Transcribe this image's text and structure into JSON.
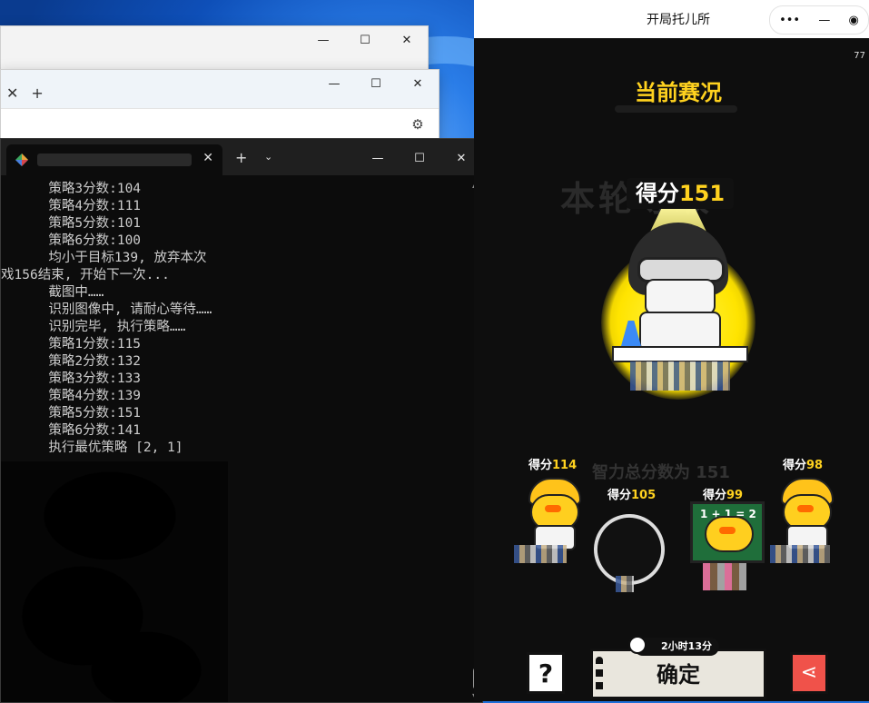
{
  "background_windows": {
    "win1_caption": {
      "min": "—",
      "max": "☐",
      "close": "✕"
    },
    "win2_tab_close": "✕",
    "win2_new_tab": "+",
    "win2_caption": {
      "min": "—",
      "max": "☐",
      "close": "✕"
    }
  },
  "terminal": {
    "tab_close": "✕",
    "new_tab": "+",
    "dropdown": "⌄",
    "caption": {
      "min": "—",
      "max": "☐",
      "close": "✕"
    },
    "lines": [
      "      策略3分数:104",
      "      策略4分数:111",
      "      策略5分数:101",
      "      策略6分数:100",
      "      均小于目标139, 放弃本次",
      "戏156结束, 开始下一次...",
      "      截图中……",
      "      识别图像中, 请耐心等待……",
      "      识别完毕, 执行策略……",
      "      策略1分数:115",
      "      策略2分数:132",
      "      策略3分数:133",
      "      策略4分数:139",
      "      策略5分数:151",
      "      策略6分数:141",
      "      执行最优策略 [2, 1]"
    ]
  },
  "mini_program": {
    "title": "开局托儿所",
    "capsule": {
      "more": "•••",
      "min": "—",
      "close": "◉"
    },
    "counter": "77",
    "heading": "当前赛况",
    "ghost_text": "本轮等级",
    "main_score": {
      "label": "得分",
      "value": "151"
    },
    "subtitle": "智力总分数为 151",
    "side_scores": [
      {
        "label": "得分",
        "value": "114"
      },
      {
        "label": "得分",
        "value": "105"
      },
      {
        "label": "得分",
        "value": "99"
      },
      {
        "label": "得分",
        "value": "98"
      }
    ],
    "board_text": "1 + 1 = 2",
    "timer": "2小时13分",
    "confirm": "确定",
    "help": "?",
    "share_icon": "share-icon"
  },
  "colors": {
    "accent_yellow": "#ffd21f",
    "share_red": "#f0524a",
    "terminal_bg": "#0c0c0c"
  }
}
